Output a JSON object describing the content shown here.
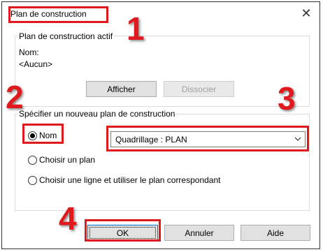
{
  "window": {
    "title": "Plan de construction",
    "close_glyph": "✕"
  },
  "active_group": {
    "legend": "Plan de construction actif",
    "name_label": "Nom:",
    "name_value": "<Aucun>",
    "show_button": "Afficher",
    "dissociate_button": "Dissocier"
  },
  "specify_group": {
    "legend": "Spécifier un nouveau plan de construction",
    "options": [
      {
        "label": "Nom",
        "checked": true
      },
      {
        "label": "Choisir un plan",
        "checked": false
      },
      {
        "label": "Choisir une ligne et utiliser le plan correspondant",
        "checked": false
      }
    ],
    "select_value": "Quadrillage : PLAN"
  },
  "buttons": {
    "ok": "OK",
    "cancel": "Annuler",
    "help": "Aide"
  },
  "callouts": {
    "one": "1",
    "two": "2",
    "three": "3",
    "four": "4"
  },
  "colors": {
    "callout": "#e0191d"
  },
  "icons": {
    "close": "close-icon",
    "dropdown": "chevron-down-icon"
  }
}
